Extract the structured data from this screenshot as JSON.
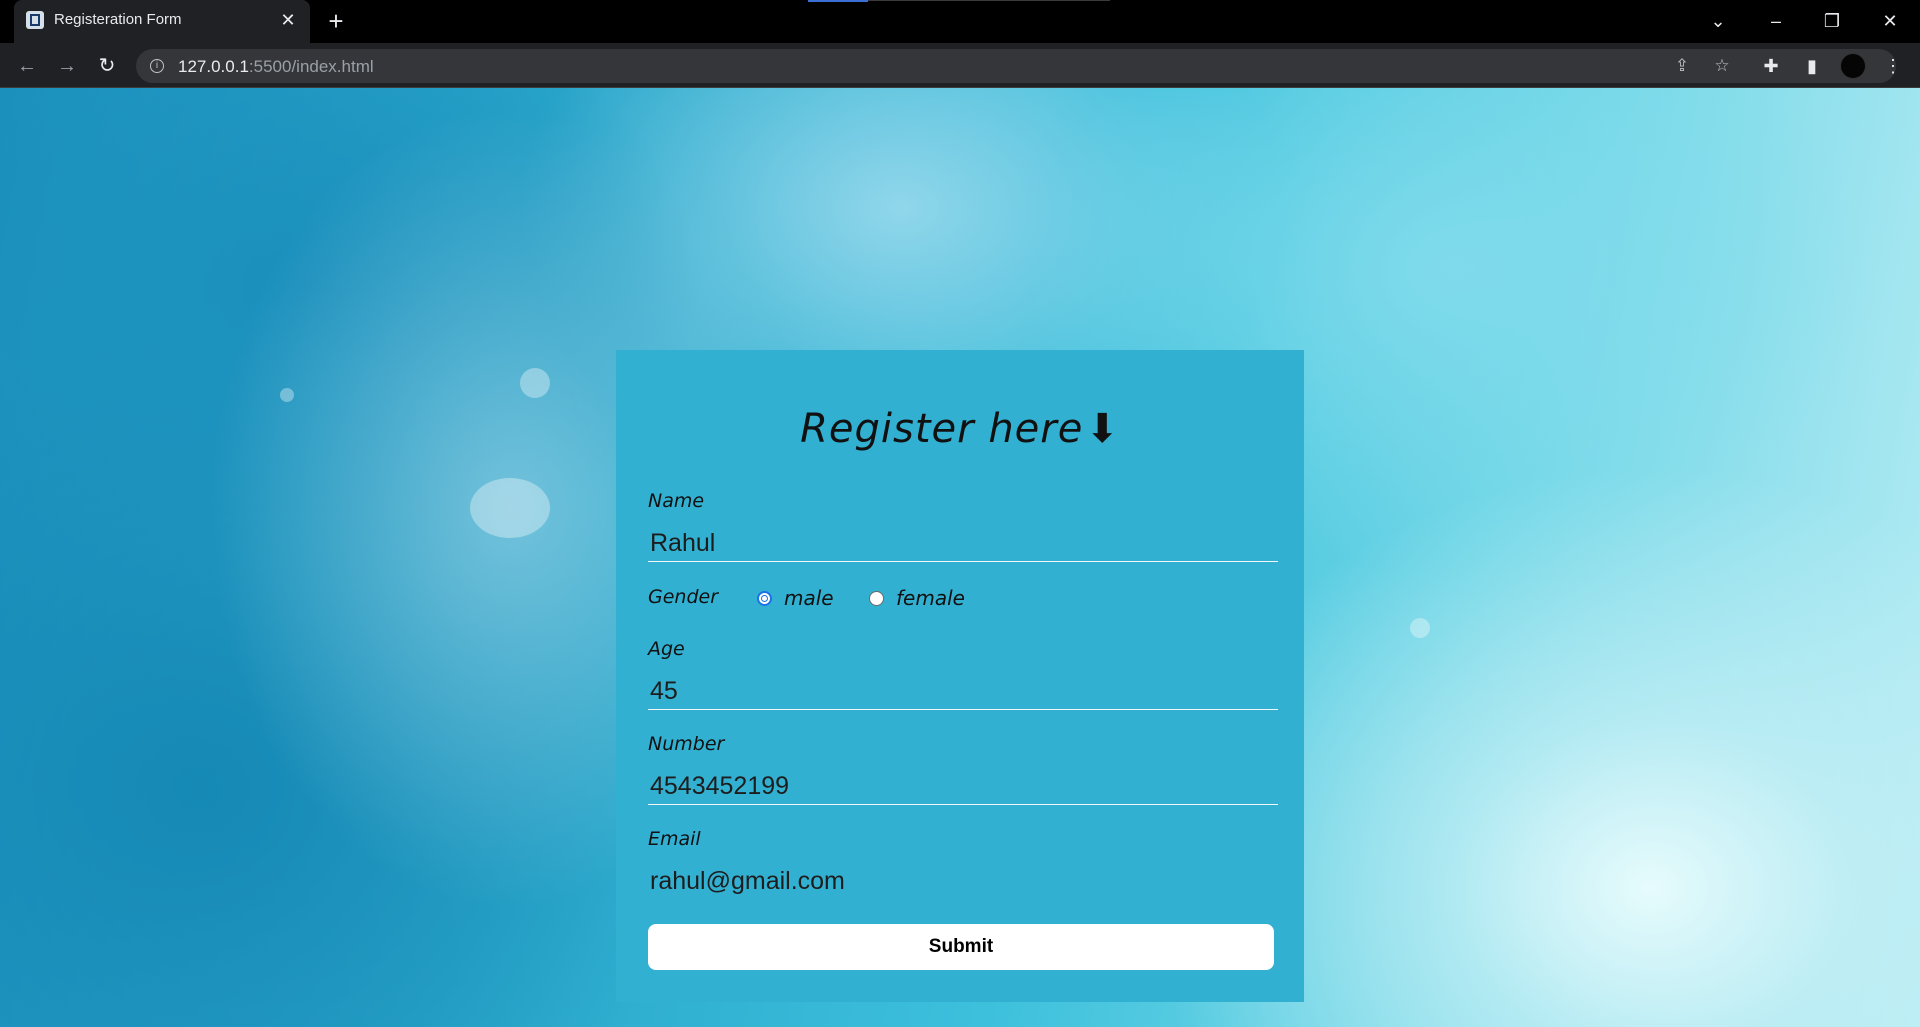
{
  "browser": {
    "tab_title": "Registeration Form",
    "url_host": "127.0.0.1",
    "url_rest": ":5500/index.html"
  },
  "form": {
    "title": "Register here",
    "title_icon": "down-arrow-icon",
    "name_label": "Name",
    "name_value": "Rahul",
    "gender_label": "Gender",
    "gender_options": [
      "male",
      "female"
    ],
    "gender_selected": "male",
    "age_label": "Age",
    "age_value": "45",
    "number_label": "Number",
    "number_value": "4543452199",
    "email_label": "Email",
    "email_value": "rahul@gmail.com",
    "submit_label": "Submit"
  },
  "colors": {
    "card_background": "#32b0d2",
    "radio_accent": "#1a73e8",
    "browser_chrome": "#202124"
  }
}
